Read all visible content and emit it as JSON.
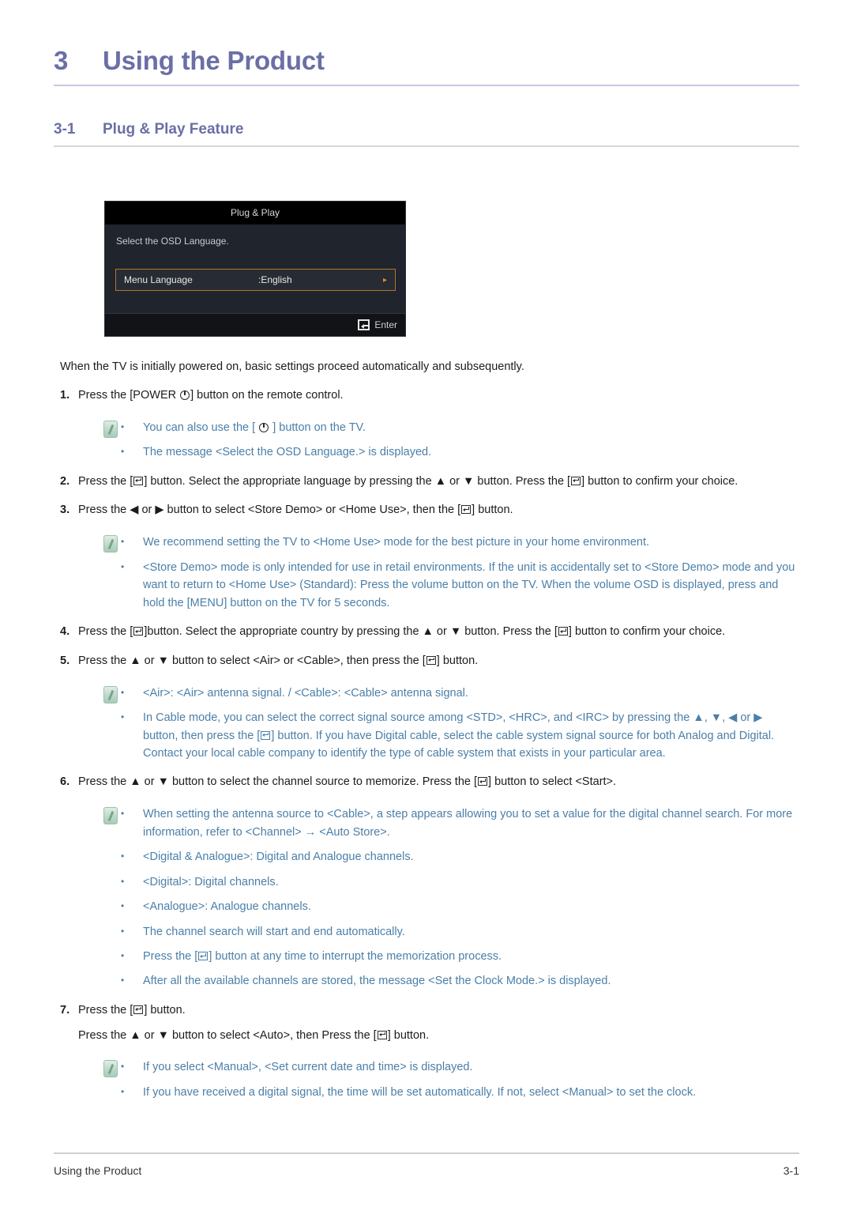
{
  "chapter": {
    "number": "3",
    "title": "Using the Product"
  },
  "section": {
    "number": "3-1",
    "title": "Plug & Play Feature"
  },
  "osd": {
    "title": "Plug & Play",
    "instruction": "Select the OSD Language.",
    "row_label": "Menu Language",
    "row_value": ":English",
    "row_arrow": "▸",
    "footer_label": "Enter",
    "footer_icon": "enter-key-icon",
    "colors": {
      "titlebar_bg": "#000000",
      "body_bg": "#20242c",
      "highlight_border": "#b2762b",
      "footer_bg": "#111316"
    }
  },
  "lead": "When the TV is initially powered on, basic settings proceed automatically and subsequently.",
  "steps": [
    {
      "num": "1.",
      "parts": [
        {
          "t": "text",
          "v": "Press the [POWER "
        },
        {
          "t": "icon",
          "v": "power-icon"
        },
        {
          "t": "text",
          "v": "] button on the remote control."
        }
      ],
      "note": {
        "icon": "note-icon",
        "items": [
          {
            "parts": [
              {
                "t": "text",
                "v": "You can also use the [ "
              },
              {
                "t": "icon",
                "v": "power-icon"
              },
              {
                "t": "text",
                "v": " ] button on the TV."
              }
            ]
          },
          {
            "parts": [
              {
                "t": "text",
                "v": "The message <Select the OSD Language.> is displayed."
              }
            ]
          }
        ]
      }
    },
    {
      "num": "2.",
      "parts": [
        {
          "t": "text",
          "v": "Press the ["
        },
        {
          "t": "icon",
          "v": "enter-key-icon"
        },
        {
          "t": "text",
          "v": "] button. Select the appropriate language by pressing the ▲ or ▼ button. Press the ["
        },
        {
          "t": "icon",
          "v": "enter-key-icon"
        },
        {
          "t": "text",
          "v": "] button to confirm your choice."
        }
      ]
    },
    {
      "num": "3.",
      "parts": [
        {
          "t": "text",
          "v": "Press the ◀ or ▶ button to select <Store Demo> or <Home Use>, then the ["
        },
        {
          "t": "icon",
          "v": "enter-key-icon"
        },
        {
          "t": "text",
          "v": "] button."
        }
      ],
      "note": {
        "icon": "note-icon",
        "items": [
          {
            "parts": [
              {
                "t": "text",
                "v": "We recommend setting the TV to <Home Use> mode for the best picture in your home environment."
              }
            ]
          },
          {
            "parts": [
              {
                "t": "text",
                "v": "<Store Demo> mode is only intended for use in retail environments. If the unit is accidentally set to <Store Demo> mode and you want to return to <Home Use> (Standard): Press the volume button on the TV. When the volume OSD is displayed, press and hold the [MENU] button on the TV for 5 seconds."
              }
            ]
          }
        ]
      }
    },
    {
      "num": "4.",
      "parts": [
        {
          "t": "text",
          "v": "Press the ["
        },
        {
          "t": "icon",
          "v": "enter-key-icon"
        },
        {
          "t": "text",
          "v": "]button. Select the appropriate country by pressing the ▲ or ▼ button. Press the ["
        },
        {
          "t": "icon",
          "v": "enter-key-icon"
        },
        {
          "t": "text",
          "v": "] button to confirm your choice."
        }
      ]
    },
    {
      "num": "5.",
      "parts": [
        {
          "t": "text",
          "v": "Press the ▲ or ▼ button to select <Air> or <Cable>, then press the ["
        },
        {
          "t": "icon",
          "v": "enter-key-icon"
        },
        {
          "t": "text",
          "v": "] button."
        }
      ],
      "note": {
        "icon": "note-icon",
        "items": [
          {
            "parts": [
              {
                "t": "text",
                "v": "<Air>: <Air> antenna signal. / <Cable>: <Cable> antenna signal."
              }
            ]
          },
          {
            "parts": [
              {
                "t": "text",
                "v": "In Cable mode, you can select the correct signal source among <STD>, <HRC>, and <IRC> by pressing the ▲, ▼, ◀ or ▶ button, then press the ["
              },
              {
                "t": "icon-blue",
                "v": "enter-key-icon"
              },
              {
                "t": "text",
                "v": "] button. If you have Digital cable, select the cable system signal source for both Analog and Digital. Contact your local cable company to identify the type of cable system that exists in your particular area."
              }
            ]
          }
        ]
      }
    },
    {
      "num": "6.",
      "parts": [
        {
          "t": "text",
          "v": "Press the ▲ or ▼ button to select the channel source to memorize. Press the ["
        },
        {
          "t": "icon",
          "v": "enter-key-icon"
        },
        {
          "t": "text",
          "v": "] button to select <Start>."
        }
      ],
      "note": {
        "icon": "note-icon",
        "items": [
          {
            "parts": [
              {
                "t": "text",
                "v": "When setting the antenna source to <Cable>, a step appears allowing you to set a value for the digital channel search. For more information, refer to <Channel> → <Auto Store>."
              }
            ]
          },
          {
            "parts": [
              {
                "t": "text",
                "v": "<Digital & Analogue>: Digital and Analogue channels."
              }
            ]
          },
          {
            "parts": [
              {
                "t": "text",
                "v": "<Digital>: Digital channels."
              }
            ]
          },
          {
            "parts": [
              {
                "t": "text",
                "v": "<Analogue>: Analogue channels."
              }
            ]
          },
          {
            "parts": [
              {
                "t": "text",
                "v": "The channel search will start and end automatically."
              }
            ]
          },
          {
            "parts": [
              {
                "t": "text",
                "v": "Press the ["
              },
              {
                "t": "icon-blue",
                "v": "enter-key-icon"
              },
              {
                "t": "text",
                "v": "] button at any time to interrupt the memorization process."
              }
            ]
          },
          {
            "parts": [
              {
                "t": "text",
                "v": "After all the available channels are stored, the message <Set the Clock Mode.> is displayed."
              }
            ]
          }
        ]
      }
    },
    {
      "num": "7.",
      "parts": [
        {
          "t": "text",
          "v": "Press the ["
        },
        {
          "t": "icon",
          "v": "enter-key-icon"
        },
        {
          "t": "text",
          "v": "] button."
        }
      ],
      "extra_parts": [
        {
          "t": "text",
          "v": "Press the ▲ or ▼ button to select <Auto>, then Press the ["
        },
        {
          "t": "icon",
          "v": "enter-key-icon"
        },
        {
          "t": "text",
          "v": "] button."
        }
      ],
      "note": {
        "icon": "note-icon",
        "items": [
          {
            "parts": [
              {
                "t": "text",
                "v": "If you select <Manual>, <Set current date and time> is displayed."
              }
            ]
          },
          {
            "parts": [
              {
                "t": "text",
                "v": "If you have received a digital signal, the time will be set automatically. If not, select <Manual> to set the clock."
              }
            ]
          }
        ]
      }
    }
  ],
  "footer": {
    "left": "Using the Product",
    "right": "3-1"
  },
  "bullet": "•",
  "colors": {
    "heading": "#6a6fa6",
    "note_text": "#4b7fa8",
    "body_text": "#1c1c1c",
    "rule": "#c8c9e2"
  }
}
